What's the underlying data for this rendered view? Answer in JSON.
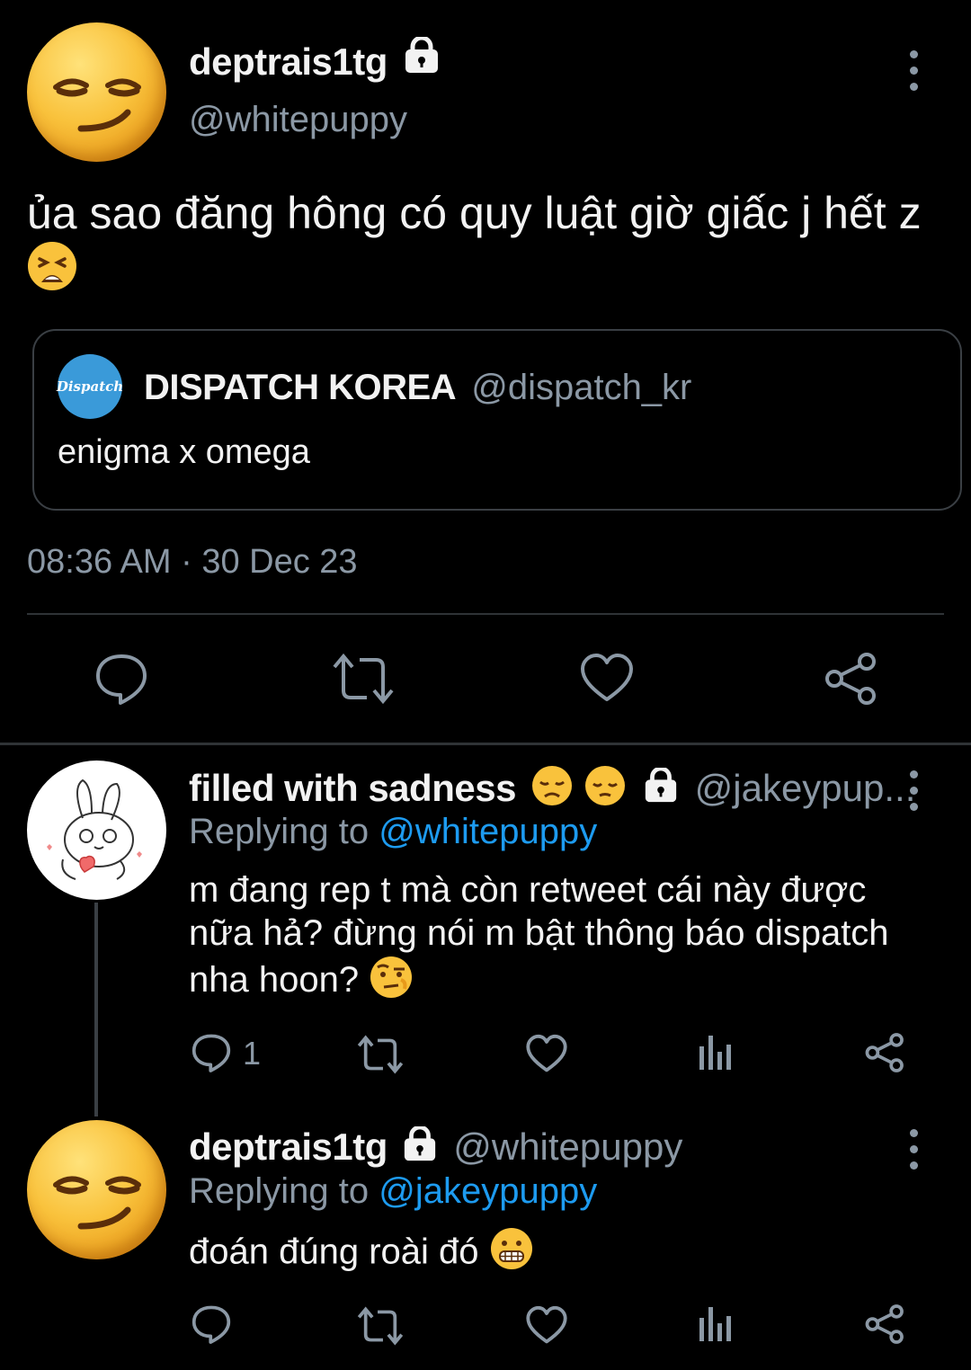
{
  "main_tweet": {
    "display_name": "deptrais1tg",
    "handle": "@whitepuppy",
    "text": "ủa sao đăng hông có quy luật giờ giấc j hết z",
    "timestamp": "08:36 AM · 30 Dec 23",
    "quoted": {
      "avatar_text": "Dispatch",
      "display_name": "DISPATCH KOREA",
      "handle": "@dispatch_kr",
      "text": "enigma x omega"
    }
  },
  "reply_1": {
    "display_name": "filled with sadness",
    "handle": "@jakeypup...",
    "replying_prefix": "Replying to",
    "replying_handle": "@whitepuppy",
    "text": "m đang rep t mà còn retweet cái này được nữa hả? đừng nói m bật thông báo dispatch nha hoon?",
    "reply_count": "1"
  },
  "reply_2": {
    "display_name": "deptrais1tg",
    "handle": "@whitepuppy",
    "replying_prefix": "Replying to",
    "replying_handle": "@jakeypuppy",
    "text": "đoán đúng roài đó"
  },
  "icons": {
    "reply": "reply-icon",
    "retweet": "retweet-icon",
    "like": "heart-icon",
    "share": "share-icon",
    "views": "views-icon",
    "more": "more-icon",
    "lock": "lock-icon"
  },
  "colors": {
    "background": "#000000",
    "text": "#e8eaed",
    "muted": "#8b98a5",
    "link": "#1d9bf0",
    "dispatch_blue": "#3a9ad9"
  }
}
